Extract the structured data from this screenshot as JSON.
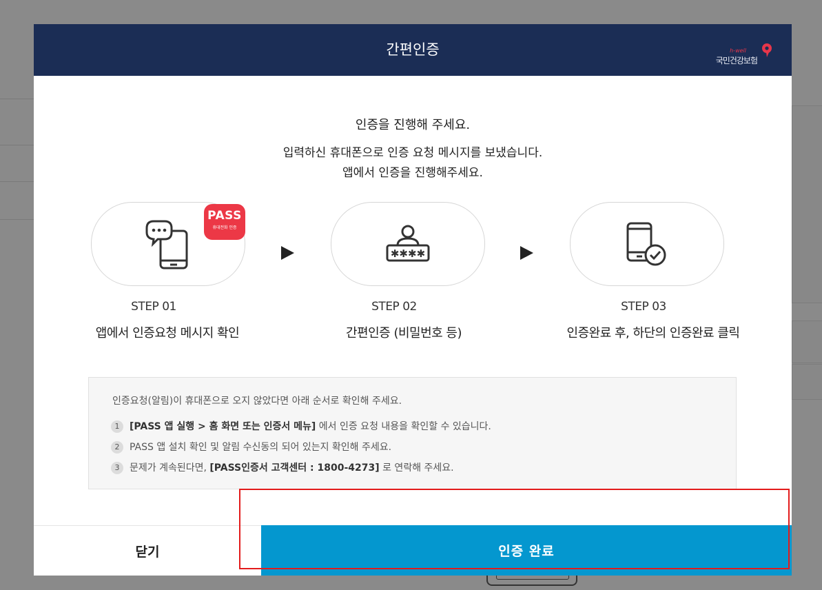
{
  "header": {
    "title": "간편인증"
  },
  "logo": {
    "small_text": "h-well",
    "brand_text": "국민건강보험"
  },
  "intro": {
    "line1": "인증을 진행해 주세요.",
    "line2": "입력하신 휴대폰으로 인증 요청 메시지를 보냈습니다.",
    "line3": "앱에서 인증을 진행해주세요."
  },
  "pass_badge": {
    "title": "PASS",
    "subtitle": "휴대전화 인증"
  },
  "steps": [
    {
      "icon": "phone-chat-icon",
      "label": "STEP 01",
      "desc": "앱에서 인증요청 메시지 확인"
    },
    {
      "icon": "password-user-icon",
      "label": "STEP 02",
      "desc": "간편인증 (비밀번호 등)"
    },
    {
      "icon": "phone-check-icon",
      "label": "STEP 03",
      "desc": "인증완료 후, 하단의 인증완료 클릭"
    }
  ],
  "notice": {
    "heading": "인증요청(알림)이 휴대폰으로 오지 않았다면 아래 순서로 확인해 주세요.",
    "items": [
      {
        "num": "1",
        "bold": "[PASS 앱 실행 > 홈 화면 또는 인증서 메뉴]",
        "text": " 에서 인증 요청 내용을 확인할 수 있습니다."
      },
      {
        "num": "2",
        "bold": "",
        "text": "PASS 앱 설치 확인 및 알림 수신동의 되어 있는지 확인해 주세요."
      },
      {
        "num": "3",
        "pre": "문제가 계속된다면, ",
        "bold": "[PASS인증서 고객센터 : 1800-4273]",
        "text": " 로 연락해 주세요."
      }
    ]
  },
  "buttons": {
    "close": "닫기",
    "done": "인증 완료"
  },
  "colors": {
    "header_bg": "#1b2d55",
    "primary": "#0497cf",
    "pass_red": "#ec3846",
    "highlight": "#e31b1b"
  }
}
